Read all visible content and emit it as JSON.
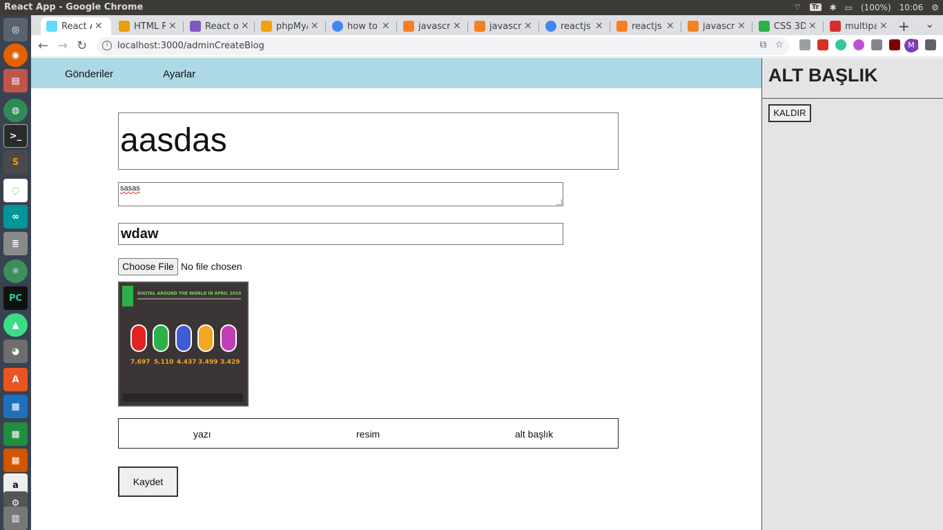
{
  "os_bar": {
    "window_title": "React App - Google Chrome",
    "keyboard": "Tr",
    "battery": "(100%)",
    "time": "10:06"
  },
  "launcher": {
    "icons": [
      "dash-icon",
      "firefox-icon",
      "files-icon",
      "chrome-icon",
      "terminal-icon",
      "sublime-icon",
      "ring-icon",
      "arduino-icon",
      "database-icon",
      "atom-icon",
      "pycharm-icon",
      "android-studio-icon",
      "gimp-icon",
      "software-center-icon",
      "writer-icon",
      "calc-icon",
      "impress-icon",
      "amazon-icon",
      "settings-icon",
      "trash-icon"
    ]
  },
  "browser": {
    "tabs": [
      {
        "label": "React App",
        "active": true,
        "color": "#61dafb"
      },
      {
        "label": "HTML Reference",
        "active": false,
        "color": "#e5a00d"
      },
      {
        "label": "React onClick",
        "active": false,
        "color": "#7e57c2"
      },
      {
        "label": "phpMyAdmin",
        "active": false,
        "color": "#f0a30a"
      },
      {
        "label": "how to",
        "active": false,
        "color": "#4285f4"
      },
      {
        "label": "javascript",
        "active": false,
        "color": "#f48024"
      },
      {
        "label": "javascript",
        "active": false,
        "color": "#f48024"
      },
      {
        "label": "reactjs",
        "active": false,
        "color": "#4285f4"
      },
      {
        "label": "reactjs",
        "active": false,
        "color": "#f48024"
      },
      {
        "label": "javascript",
        "active": false,
        "color": "#f48024"
      },
      {
        "label": "CSS 3D",
        "active": false,
        "color": "#2bb14a"
      },
      {
        "label": "multipart",
        "active": false,
        "color": "#d32f2f"
      }
    ],
    "url": "localhost:3000/adminCreateBlog",
    "profile_initial": "M"
  },
  "page": {
    "nav": {
      "posts": "Gönderiler",
      "settings": "Ayarlar"
    },
    "title_value": "aasdas",
    "description_value": "sasas",
    "subtitle_value": "wdaw",
    "file": {
      "button": "Choose File",
      "status": "No file chosen"
    },
    "image": {
      "heading": "DIGITAL AROUND THE WORLD IN APRIL 2019",
      "values": [
        "7.697",
        "5.110",
        "4.437",
        "3.499",
        "3.429"
      ],
      "colors": [
        "#e02424",
        "#2bb14a",
        "#3f5bd6",
        "#f6a623",
        "#c03fb8"
      ]
    },
    "block_options": [
      "yazı",
      "resim",
      "alt başlık"
    ],
    "save_button": "Kaydet"
  },
  "side_panel": {
    "title": "ALT BAŞLIK",
    "remove_button": "KALDIR"
  }
}
